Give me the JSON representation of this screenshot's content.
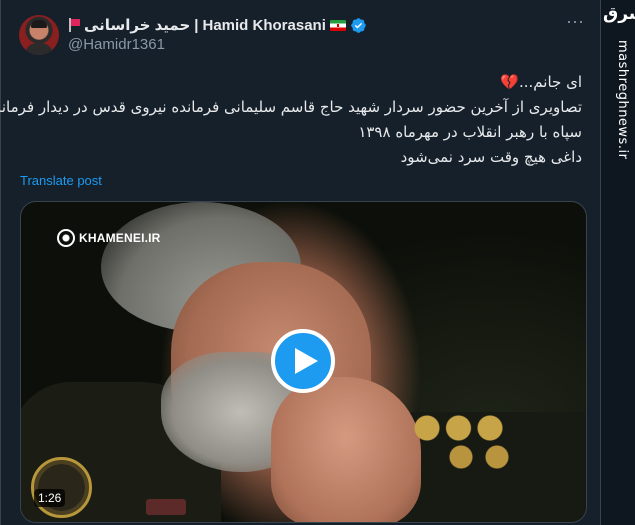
{
  "tweet": {
    "display_name": "Hamid Khorasani",
    "display_name_fa": "حمید خراسانی",
    "handle": "@Hamidr1361",
    "text_lines": [
      "ای جانم...💔",
      "تصاویری از آخرین حضور سردار شهید حاج قاسم سلیمانی فرمانده نیروی قدس در دیدار فرماندهان",
      "سپاه با رهبر انقلاب در مهرماه ۱۳۹۸",
      "داغی هیچ وقت سرد نمی‌شود"
    ],
    "translate_label": "Translate post"
  },
  "media": {
    "logo_text": "KHAMENEI.IR",
    "duration": "1:26"
  },
  "watermark": {
    "logo": "مشرق",
    "site": "mashreghnews.ir"
  },
  "icons": {
    "verified": "verified-badge-icon",
    "more": "more-options-icon",
    "play": "play-icon",
    "flag_iran": "iran-flag-icon",
    "flag_red": "red-flag-icon"
  },
  "colors": {
    "background": "#15202b",
    "text": "#e7e9ea",
    "secondary_text": "#8b98a5",
    "accent": "#1d9bf0"
  }
}
